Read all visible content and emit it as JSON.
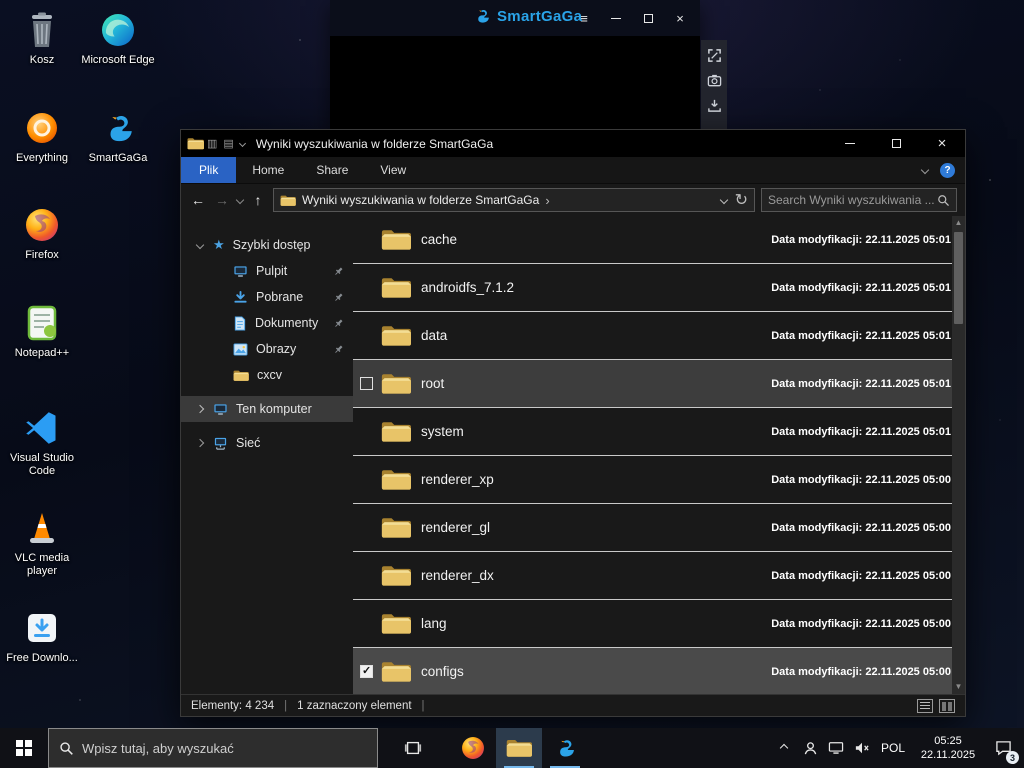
{
  "desktop": {
    "icons": [
      {
        "label": "Kosz"
      },
      {
        "label": "Microsoft Edge"
      },
      {
        "label": "Everything"
      },
      {
        "label": "SmartGaGa"
      },
      {
        "label": "Firefox"
      },
      {
        "label": "Notepad++"
      },
      {
        "label": "Visual Studio Code"
      },
      {
        "label": "VLC media player"
      },
      {
        "label": "Free Downlo..."
      }
    ]
  },
  "smartgaga": {
    "title": "SmartGaGa"
  },
  "explorer": {
    "title": "Wyniki wyszukiwania w folderze SmartGaGa",
    "tabs": {
      "file": "Plik",
      "home": "Home",
      "share": "Share",
      "view": "View"
    },
    "help": "?",
    "breadcrumb": "Wyniki wyszukiwania w folderze SmartGaGa",
    "search_placeholder": "Search Wyniki wyszukiwania ...",
    "sidebar": {
      "quick_access": "Szybki dostęp",
      "desktop": "Pulpit",
      "downloads": "Pobrane",
      "documents": "Dokumenty",
      "pictures": "Obrazy",
      "cxcv": "cxcv",
      "this_pc": "Ten komputer",
      "network": "Sieć"
    },
    "files": [
      {
        "name": "cache",
        "modified": "Data modyfikacji: 22.11.2025 05:01"
      },
      {
        "name": "androidfs_7.1.2",
        "modified": "Data modyfikacji: 22.11.2025 05:01"
      },
      {
        "name": "data",
        "modified": "Data modyfikacji: 22.11.2025 05:01"
      },
      {
        "name": "root",
        "modified": "Data modyfikacji: 22.11.2025 05:01"
      },
      {
        "name": "system",
        "modified": "Data modyfikacji: 22.11.2025 05:01"
      },
      {
        "name": "renderer_xp",
        "modified": "Data modyfikacji: 22.11.2025 05:00"
      },
      {
        "name": "renderer_gl",
        "modified": "Data modyfikacji: 22.11.2025 05:00"
      },
      {
        "name": "renderer_dx",
        "modified": "Data modyfikacji: 22.11.2025 05:00"
      },
      {
        "name": "lang",
        "modified": "Data modyfikacji: 22.11.2025 05:00"
      },
      {
        "name": "configs",
        "modified": "Data modyfikacji: 22.11.2025 05:00"
      }
    ],
    "status": {
      "items_count": "Elementy: 4 234",
      "selected_count": "1 zaznaczony element"
    }
  },
  "taskbar": {
    "search_placeholder": "Wpisz tutaj, aby wyszukać",
    "language": "POL",
    "time": "05:25",
    "date": "22.11.2025",
    "notification_count": "3"
  }
}
